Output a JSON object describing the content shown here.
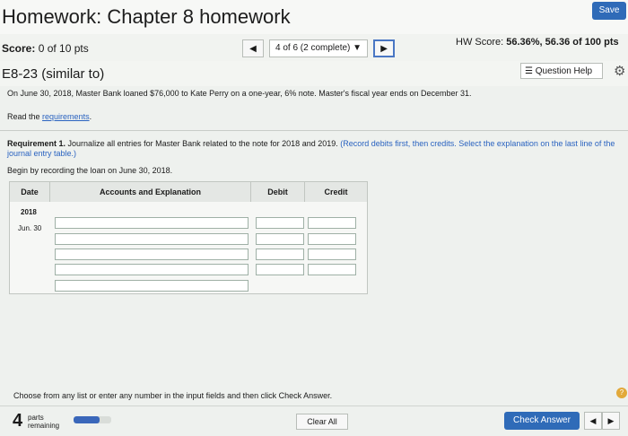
{
  "header": {
    "title": "Homework: Chapter 8 homework",
    "save_label": "Save"
  },
  "score": {
    "label": "Score:",
    "value": "0 of 10 pts"
  },
  "navigation": {
    "prev_icon": "left-triangle-icon",
    "position_label": "4 of 6 (2 complete)",
    "dropdown_icon": "down-triangle-icon",
    "next_icon": "right-triangle-icon"
  },
  "hw_score": {
    "label": "HW Score:",
    "value": "56.36%, 56.36 of 100 pts"
  },
  "problem": {
    "id": "E8-23 (similar to)",
    "help_label": "Question Help",
    "help_icon": "list-icon",
    "settings_icon": "gear-icon"
  },
  "content": {
    "prompt": "On June 30, 2018, Master Bank loaned $76,000 to Kate Perry on a one-year, 6% note. Master's fiscal year ends on December 31.",
    "read_text": "Read the",
    "requirements_link": "requirements",
    "period": ".",
    "requirement_label": "Requirement 1.",
    "requirement_text": "Journalize all entries for Master Bank related to the note for 2018 and 2019.",
    "requirement_hint": "(Record debits first, then credits. Select the explanation on the last line of the journal entry table.)",
    "begin_text": "Begin by recording the loan on June 30, 2018."
  },
  "journal": {
    "headers": {
      "date": "Date",
      "accounts": "Accounts and Explanation",
      "debit": "Debit",
      "credit": "Credit"
    },
    "year": "2018",
    "date": "Jun. 30",
    "rows": [
      {
        "account": "",
        "debit": "",
        "credit": ""
      },
      {
        "account": "",
        "debit": "",
        "credit": ""
      },
      {
        "account": "",
        "debit": "",
        "credit": ""
      },
      {
        "account": "",
        "debit": "",
        "credit": ""
      },
      {
        "account": "",
        "debit": "",
        "credit": ""
      }
    ]
  },
  "footer": {
    "instruction": "Choose from any list or enter any number in the input fields and then click Check Answer.",
    "help_icon": "question-icon",
    "parts_remaining_count": "4",
    "parts_label_1": "parts",
    "parts_label_2": "remaining",
    "parts_progress": 0.7,
    "clear_label": "Clear All",
    "check_label": "Check Answer",
    "prev_icon": "left-triangle-icon",
    "next_icon": "right-triangle-icon"
  },
  "colors": {
    "accent": "#2f6bb8",
    "link": "#2a63c0",
    "help_badge": "#e2a93a"
  }
}
